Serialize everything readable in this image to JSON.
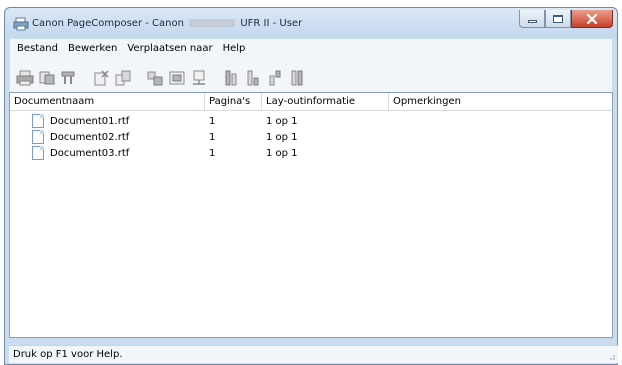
{
  "window": {
    "title_prefix": "Canon PageComposer - Canon",
    "title_suffix": "UFR II - User",
    "icons": {
      "app": "printer-app-icon",
      "minimize": "minimize-icon",
      "maximize": "maximize-icon",
      "close": "close-icon"
    },
    "colors": {
      "titlebar": "#c9dcf0",
      "close": "#c7402a"
    }
  },
  "menubar": {
    "items": [
      {
        "label": "Bestand"
      },
      {
        "label": "Bewerken"
      },
      {
        "label": "Verplaatsen naar"
      },
      {
        "label": "Help"
      }
    ]
  },
  "toolbar": {
    "buttons": [
      {
        "icon": "print-icon"
      },
      {
        "icon": "print-preview-icon"
      },
      {
        "icon": "properties-icon"
      },
      {
        "icon": "delete-icon"
      },
      {
        "icon": "duplicate-icon"
      },
      {
        "icon": "combine-icon"
      },
      {
        "icon": "split-icon"
      },
      {
        "icon": "page-setup-icon"
      },
      {
        "icon": "move-to-top-icon"
      },
      {
        "icon": "move-down-icon"
      },
      {
        "icon": "move-up-icon"
      },
      {
        "icon": "move-to-bottom-icon"
      }
    ]
  },
  "list": {
    "columns": [
      "Documentnaam",
      "Pagina's",
      "Lay-outinformatie",
      "Opmerkingen"
    ],
    "rows": [
      {
        "name": "Document01.rtf",
        "pages": "1",
        "layout": "1 op 1",
        "notes": ""
      },
      {
        "name": "Document02.rtf",
        "pages": "1",
        "layout": "1 op 1",
        "notes": ""
      },
      {
        "name": "Document03.rtf",
        "pages": "1",
        "layout": "1 op 1",
        "notes": ""
      }
    ]
  },
  "statusbar": {
    "text": "Druk op F1 voor Help."
  }
}
